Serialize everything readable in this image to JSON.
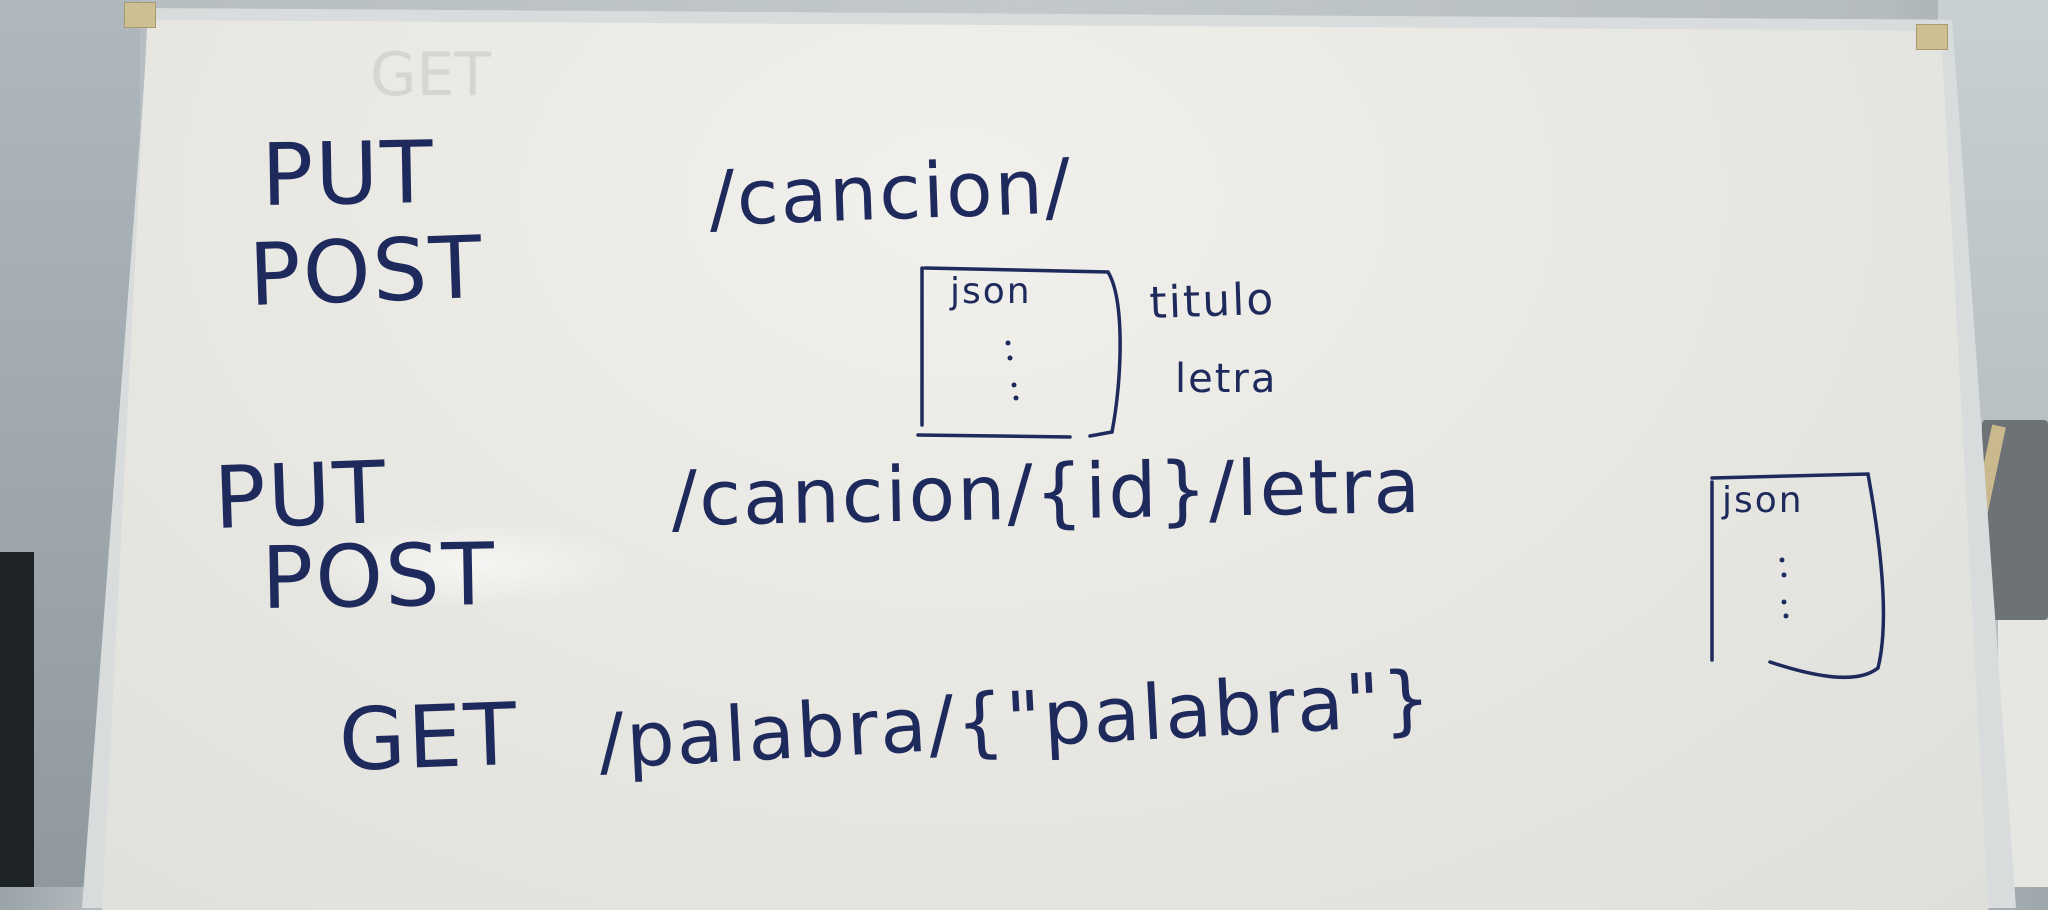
{
  "whiteboard": {
    "ghost_text": "GET",
    "line1": {
      "methods": [
        "PUT",
        "POST"
      ],
      "path": "/cancion/",
      "json_label": "json",
      "fields": [
        "titulo",
        "letra"
      ]
    },
    "line2": {
      "methods": [
        "PUT",
        "POST"
      ],
      "path": "/cancion/{id}/letra",
      "json_label": "json"
    },
    "line3": {
      "method": "GET",
      "path": "/palabra/{\"palabra\"}"
    }
  },
  "colors": {
    "ink": "#1f2a5c",
    "board": "#ecebe6",
    "frame": "#d8dcdc"
  }
}
